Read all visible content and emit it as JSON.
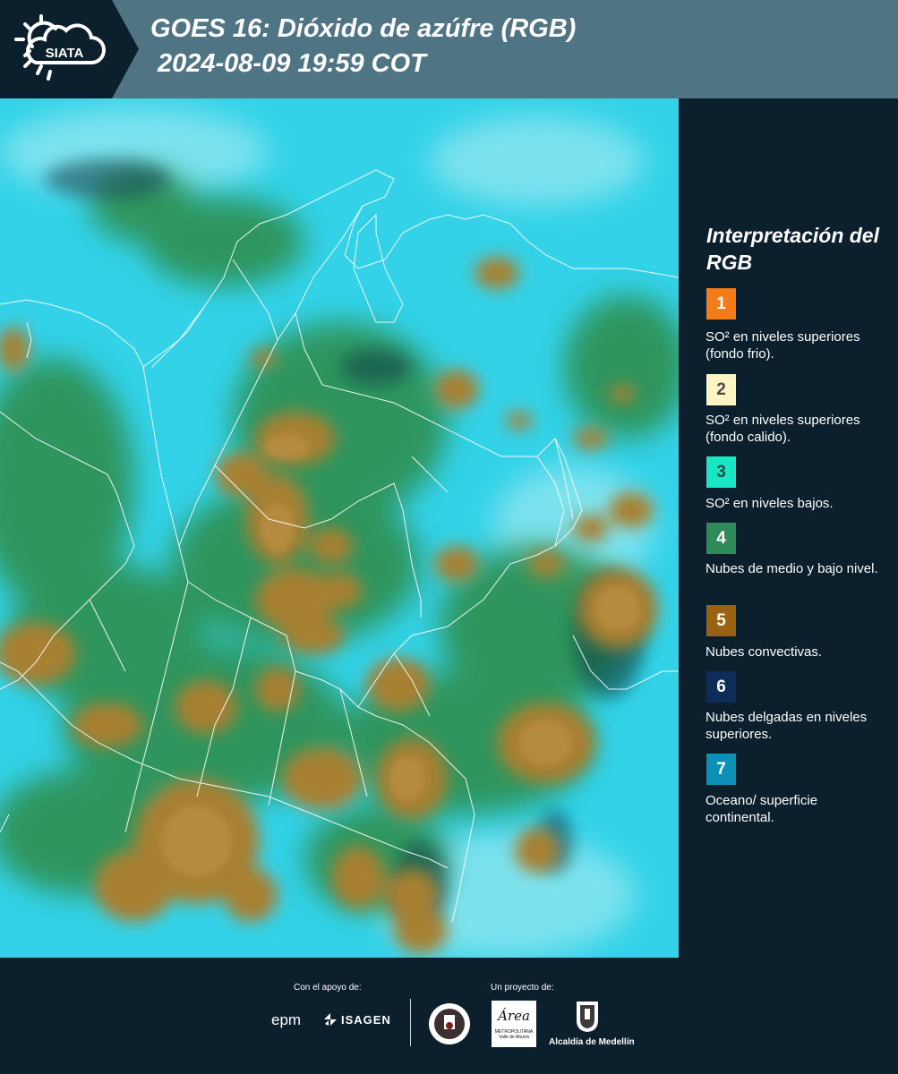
{
  "header": {
    "logo_text": "SIATA",
    "title_line1": "GOES 16: Dióxido de azúfre (RGB)",
    "title_line2": "2024-08-09 19:59 COT"
  },
  "legend": {
    "title": "Interpretación del RGB",
    "items": [
      {
        "number": "1",
        "color": "#f47b16",
        "text_color": "#ffffff",
        "description": "SO² en niveles superiores (fondo frio)."
      },
      {
        "number": "2",
        "color": "#fdf4c2",
        "text_color": "#4a4a4a",
        "description": "SO² en niveles superiores (fondo calido)."
      },
      {
        "number": "3",
        "color": "#19e7c4",
        "text_color": "#234a44",
        "description": "SO² en niveles bajos."
      },
      {
        "number": "4",
        "color": "#2e8a59",
        "text_color": "#ffffff",
        "description": "Nubes de medio y bajo nivel."
      },
      {
        "number": "5",
        "color": "#996110",
        "text_color": "#ffffff",
        "description": "Nubes convectivas."
      },
      {
        "number": "6",
        "color": "#0d2c58",
        "text_color": "#ffffff",
        "description": "Nubes delgadas en niveles superiores."
      },
      {
        "number": "7",
        "color": "#0d90b5",
        "text_color": "#ffffff",
        "description": "Oceano/ superficie continental."
      }
    ]
  },
  "footer": {
    "support_label": "Con el apoyo de:",
    "project_label": "Un proyecto de:",
    "epm_logo": "epm",
    "isagen_logo": "ISAGEN",
    "area_logo_text": "Área",
    "area_logo_sub": "METROPOLITANA",
    "area_logo_sub2": "Valle de Aburrá",
    "alcaldia_label": "Alcaldía de Medellín"
  },
  "map": {
    "colors": {
      "ocean_land": "#33d2e8",
      "ocean_light": "#8fe6f0",
      "mid_low_clouds": "#2f8f50",
      "convective": "#a88030",
      "convective_light": "#bf9348",
      "thin_clouds": "#10414a",
      "border": "#ffffff"
    }
  }
}
